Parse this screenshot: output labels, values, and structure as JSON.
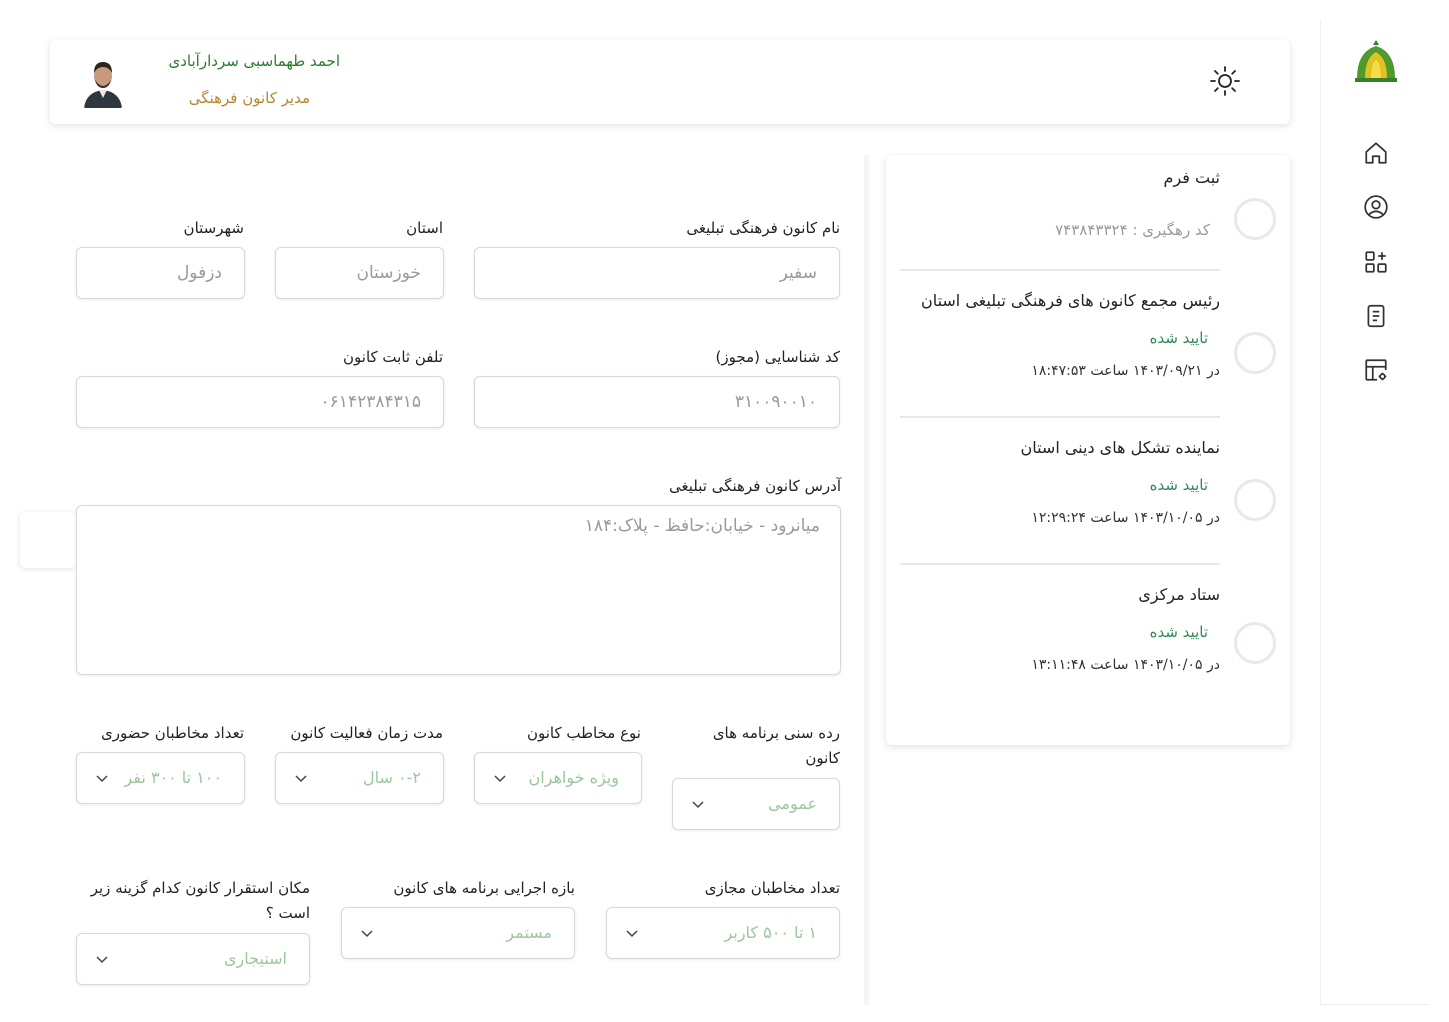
{
  "header": {
    "user_name": "احمد طهماسبی سردارآبادی",
    "user_role": "مدیر کانون فرهنگی"
  },
  "sidebar": {
    "logo": "mosque-logo-icon",
    "items": [
      {
        "icon": "home-icon"
      },
      {
        "icon": "user-circle-icon"
      },
      {
        "icon": "apps-add-icon"
      },
      {
        "icon": "document-icon"
      },
      {
        "icon": "table-settings-icon"
      }
    ]
  },
  "form": {
    "name_label": "نام کانون فرهنگی تبلیغی",
    "name_value": "سفیر",
    "province_label": "استان",
    "province_value": "خوزستان",
    "city_label": "شهرستان",
    "city_value": "دزفول",
    "license_label": "کد شناسایی (مجوز)",
    "license_value": "۳۱۰۰۹۰۰۱۰",
    "phone_label": "تلفن ثابت کانون",
    "phone_value": "۰۶۱۴۲۳۸۴۳۱۵",
    "address_label": "آدرس کانون فرهنگی تبلیغی",
    "address_value": "میانرود - خیابان:حافظ - پلاک:۱۸۴",
    "age_label": "رده سنی برنامه های کانون",
    "age_value": "عمومی",
    "audience_type_label": "نوع مخاطب کانون",
    "audience_type_value": "ویژه خواهران",
    "duration_label": "مدت زمان فعالیت کانون",
    "duration_value": "۰-۲ سال",
    "inperson_label": "تعداد مخاطبان حضوری",
    "inperson_value": "۱۰۰ تا ۳۰۰ نفر",
    "virtual_label": "تعداد مخاطبان مجازی",
    "virtual_value": "۱ تا ۵۰۰ کاربر",
    "period_label": "بازه اجرایی برنامه های کانون",
    "period_value": "مستمر",
    "location_label": "مکان استقرار کانون کدام گزینه زیر است ؟",
    "location_value": "استیجاری"
  },
  "panel": {
    "submit_title": "ثبت فرم",
    "tracking": "کد رهگیری : ۷۴۳۸۴۳۳۲۴",
    "steps": [
      {
        "title": "رئیس مجمع کانون های فرهنگی تبلیغی استان",
        "status": "تایید شده",
        "when": "در ۱۴۰۳/۰۹/۲۱ ساعت ۱۸:۴۷:۵۳"
      },
      {
        "title": "نماینده تشکل های دینی استان",
        "status": "تایید شده",
        "when": "در ۱۴۰۳/۱۰/۰۵ ساعت ۱۲:۲۹:۲۴"
      },
      {
        "title": "ستاد مرکزی",
        "status": "تایید شده",
        "when": "در ۱۴۰۳/۱۰/۰۵ ساعت ۱۳:۱۱:۴۸"
      }
    ]
  },
  "colors": {
    "accent_green": "#2e7d32",
    "role_gold": "#b8862c",
    "status_green": "#2e8b57"
  }
}
